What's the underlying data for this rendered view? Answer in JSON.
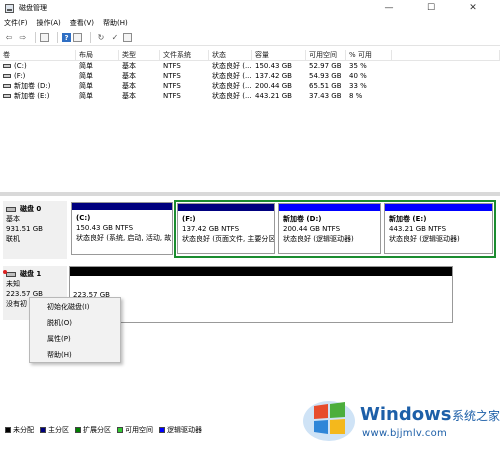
{
  "window": {
    "title": "磁盘管理",
    "minimize": "—",
    "maximize": "☐",
    "close": "✕"
  },
  "menu": [
    "文件(F)",
    "操作(A)",
    "查看(V)",
    "帮助(H)"
  ],
  "toolbar": [
    "back-icon",
    "forward-icon",
    "properties-icon",
    "help-icon",
    "disk-view-icon",
    "refresh-icon",
    "check-icon",
    "list-icon"
  ],
  "volumes": {
    "columns": [
      "卷",
      "布局",
      "类型",
      "文件系统",
      "状态",
      "容量",
      "可用空间",
      "% 可用"
    ],
    "rows": [
      [
        "(C:)",
        "简单",
        "基本",
        "NTFS",
        "状态良好 (...",
        "150.43 GB",
        "52.97 GB",
        "35 %"
      ],
      [
        "(F:)",
        "简单",
        "基本",
        "NTFS",
        "状态良好 (...",
        "137.42 GB",
        "54.93 GB",
        "40 %"
      ],
      [
        "新加卷 (D:)",
        "简单",
        "基本",
        "NTFS",
        "状态良好 (...",
        "200.44 GB",
        "65.51 GB",
        "33 %"
      ],
      [
        "新加卷 (E:)",
        "简单",
        "基本",
        "NTFS",
        "状态良好 (...",
        "443.21 GB",
        "37.43 GB",
        "8 %"
      ]
    ]
  },
  "disk0": {
    "name": "磁盘 0",
    "type": "基本",
    "size": "931.51 GB",
    "status": "联机",
    "partitions": [
      {
        "label": "(C:)",
        "size": "150.43 GB NTFS",
        "status": "状态良好 (系统, 启动, 活动, 故",
        "selected": false
      },
      {
        "label": "(F:)",
        "size": "137.42 GB NTFS",
        "status": "状态良好 (页面文件, 主要分区",
        "selected": true
      },
      {
        "label": "新加卷  (D:)",
        "size": "200.44 GB NTFS",
        "status": "状态良好 (逻辑驱动器)",
        "selected": true
      },
      {
        "label": "新加卷  (E:)",
        "size": "443.21 GB NTFS",
        "status": "状态良好 (逻辑驱动器)",
        "selected": true
      }
    ]
  },
  "disk1": {
    "name": "磁盘 1",
    "type": "未知",
    "size": "223.57 GB",
    "status": "没有初",
    "partition_size": "223.57 GB"
  },
  "context_menu": [
    "初始化磁盘(I)",
    "脱机(O)",
    "属性(P)",
    "帮助(H)"
  ],
  "legend": [
    {
      "label": "未分配",
      "color": "#000000"
    },
    {
      "label": "主分区",
      "color": "#00007f"
    },
    {
      "label": "扩展分区",
      "color": "#007f00"
    },
    {
      "label": "可用空间",
      "color": "#33cc33"
    },
    {
      "label": "逻辑驱动器",
      "color": "#0000ff"
    }
  ],
  "watermark": {
    "brand": "Windows",
    "cn": "系统之家",
    "url": "www.bjjmlv.com"
  },
  "colors": {
    "primary": "#00007f",
    "logical": "#0000ff",
    "unallocated": "#000000",
    "selection": "#1b8c2f",
    "brand": "#1d5fa8"
  }
}
